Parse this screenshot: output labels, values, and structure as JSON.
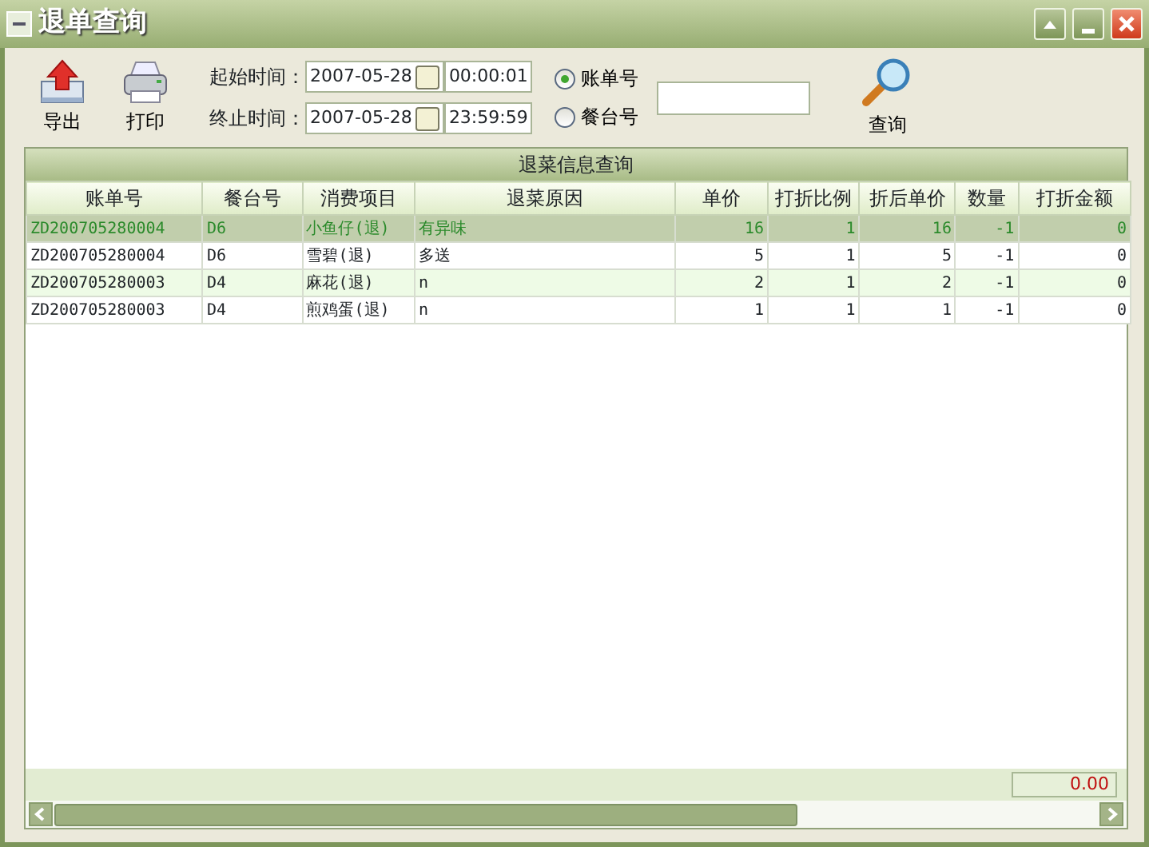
{
  "window": {
    "title": "退单查询"
  },
  "toolbar": [
    {
      "kind": "export",
      "label": "导出"
    },
    {
      "kind": "print",
      "label": "打印"
    }
  ],
  "time_range": [
    {
      "label": "起始时间：",
      "date": "2007-05-28",
      "time": "00:00:01"
    },
    {
      "label": "终止时间：",
      "date": "2007-05-28",
      "time": "23:59:59"
    }
  ],
  "search_by": [
    {
      "label": "账单号",
      "selected": true
    },
    {
      "label": "餐台号",
      "selected": false
    }
  ],
  "query_button": {
    "label": "查询"
  },
  "grid": {
    "title": "退菜信息查询",
    "columns": [
      "账单号",
      "餐台号",
      "消费项目",
      "退菜原因",
      "单价",
      "打折比例",
      "折后单价",
      "数量",
      "打折金额"
    ],
    "rows": [
      {
        "selected": true,
        "cells": [
          "ZD200705280004",
          "D6",
          "小鱼仔(退)",
          "有异味",
          "16",
          "1",
          "16",
          "-1",
          "0"
        ]
      },
      {
        "selected": false,
        "cells": [
          "ZD200705280004",
          "D6",
          "雪碧(退)",
          "多送",
          "5",
          "1",
          "5",
          "-1",
          "0"
        ]
      },
      {
        "selected": false,
        "cells": [
          "ZD200705280003",
          "D4",
          "麻花(退)",
          "n",
          "2",
          "1",
          "2",
          "-1",
          "0"
        ]
      },
      {
        "selected": false,
        "cells": [
          "ZD200705280003",
          "D4",
          "煎鸡蛋(退)",
          "n",
          "1",
          "1",
          "1",
          "-1",
          "0"
        ]
      }
    ],
    "total": "0.00"
  }
}
